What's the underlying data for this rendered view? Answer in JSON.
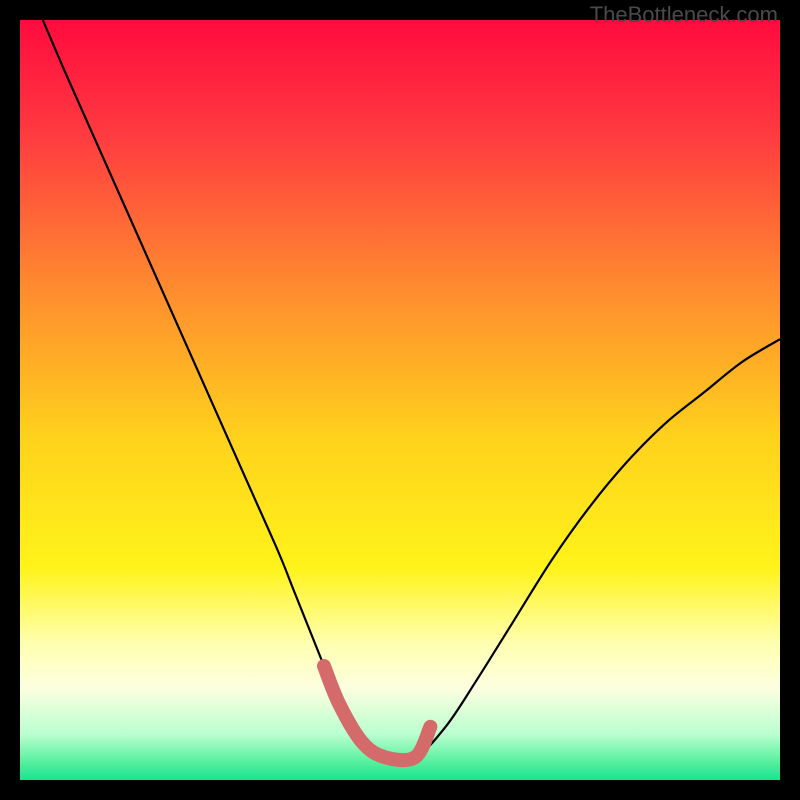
{
  "watermark": "TheBottleneck.com",
  "chart_data": {
    "type": "line",
    "title": "",
    "xlabel": "",
    "ylabel": "",
    "xlim": [
      0,
      100
    ],
    "ylim": [
      0,
      100
    ],
    "series": [
      {
        "name": "curve",
        "x": [
          3,
          6,
          10,
          14,
          18,
          22,
          26,
          30,
          34,
          36,
          38,
          40,
          42,
          45,
          48,
          52,
          56,
          60,
          65,
          70,
          75,
          80,
          85,
          90,
          95,
          100
        ],
        "y": [
          100,
          93,
          84,
          75,
          66,
          57,
          48,
          39,
          30,
          25,
          20,
          15,
          10,
          5,
          3,
          3,
          7,
          13,
          21,
          29,
          36,
          42,
          47,
          51,
          55,
          58
        ]
      },
      {
        "name": "highlight",
        "x": [
          40,
          42,
          45,
          48,
          52,
          54
        ],
        "y": [
          15,
          10,
          5,
          3,
          3,
          7
        ]
      }
    ],
    "gradient_stops": [
      {
        "offset": 0.0,
        "color": "#ff0b3e"
      },
      {
        "offset": 0.15,
        "color": "#ff3a40"
      },
      {
        "offset": 0.35,
        "color": "#ff8a2f"
      },
      {
        "offset": 0.55,
        "color": "#ffd21c"
      },
      {
        "offset": 0.72,
        "color": "#fff31a"
      },
      {
        "offset": 0.82,
        "color": "#ffffb0"
      },
      {
        "offset": 0.88,
        "color": "#fcffe0"
      },
      {
        "offset": 0.94,
        "color": "#b9ffcf"
      },
      {
        "offset": 0.975,
        "color": "#5af0a0"
      },
      {
        "offset": 1.0,
        "color": "#19e48f"
      }
    ],
    "highlight_color": "#d46a6a",
    "curve_color": "#000000"
  }
}
